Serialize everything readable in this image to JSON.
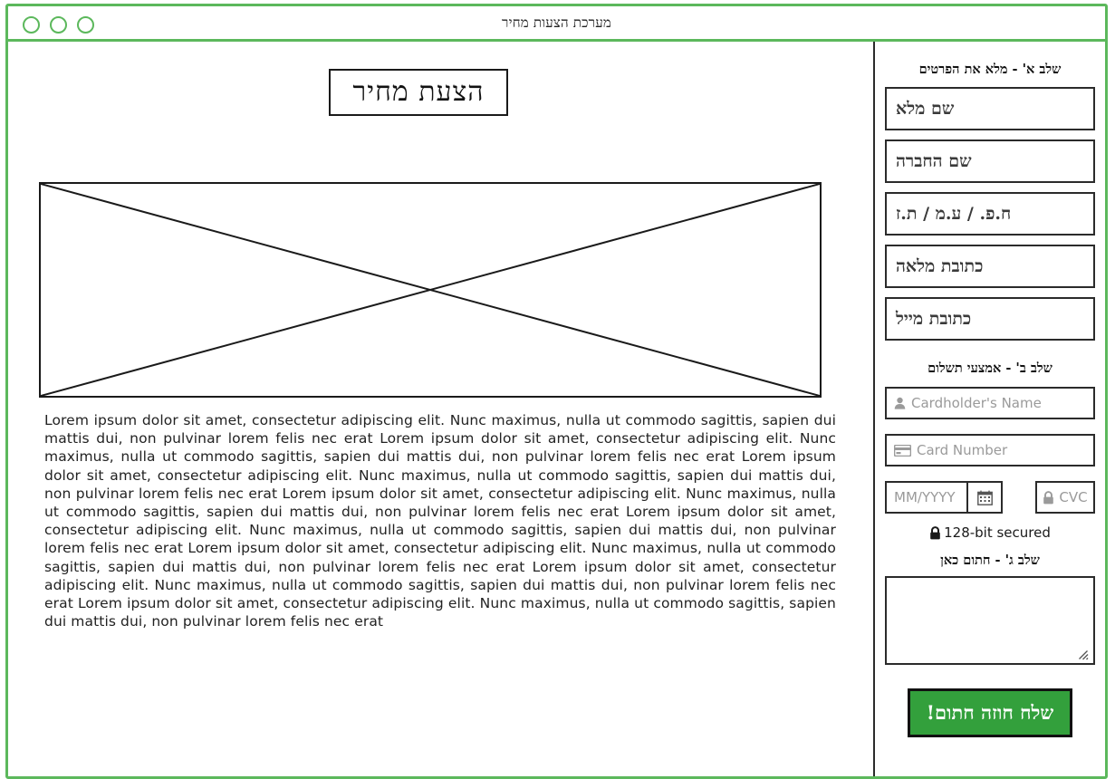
{
  "window": {
    "title": "מערכת הצעות מחיר",
    "controls": [
      "circle-1",
      "circle-2",
      "circle-3"
    ],
    "accent_color": "#5cb85c"
  },
  "content": {
    "document_title": "הצעת מחיר",
    "image_placeholder": "image-placeholder",
    "body_text": "Lorem ipsum dolor sit amet, consectetur adipiscing elit. Nunc maximus, nulla ut commodo sagittis, sapien dui mattis dui, non pulvinar lorem felis nec erat Lorem ipsum dolor sit amet, consectetur adipiscing elit. Nunc maximus, nulla ut commodo sagittis, sapien dui mattis dui, non pulvinar lorem felis nec erat Lorem ipsum dolor sit amet, consectetur adipiscing elit. Nunc maximus, nulla ut commodo sagittis, sapien dui mattis dui, non pulvinar lorem felis nec erat Lorem ipsum dolor sit amet, consectetur adipiscing elit. Nunc maximus, nulla ut commodo sagittis, sapien dui mattis dui, non pulvinar lorem felis nec erat Lorem ipsum dolor sit amet, consectetur adipiscing elit. Nunc maximus, nulla ut commodo sagittis, sapien dui mattis dui, non pulvinar lorem felis nec erat Lorem ipsum dolor sit amet, consectetur adipiscing elit. Nunc maximus, nulla ut commodo sagittis, sapien dui mattis dui, non pulvinar lorem felis nec erat Lorem ipsum dolor sit amet, consectetur adipiscing elit. Nunc maximus, nulla ut commodo sagittis, sapien dui mattis dui, non pulvinar lorem felis nec erat Lorem ipsum dolor sit amet, consectetur adipiscing elit. Nunc maximus, nulla ut commodo sagittis, sapien dui mattis dui, non pulvinar lorem felis nec erat"
  },
  "sidebar": {
    "step_a": {
      "label": "שלב א' - מלא את הפרטים",
      "fields": [
        {
          "name": "full-name",
          "label": "שם מלא"
        },
        {
          "name": "company-name",
          "label": "שם החברה"
        },
        {
          "name": "company-id",
          "label": "ח.פ. / ע.מ / ת.ז"
        },
        {
          "name": "full-address",
          "label": "כתובת מלאה"
        },
        {
          "name": "email-address",
          "label": "כתובת מייל"
        }
      ]
    },
    "step_b": {
      "label": "שלב ב' - אמצעי תשלום",
      "cardholder_placeholder": "Cardholder's Name",
      "cardnumber_placeholder": "Card Number",
      "expiry_placeholder": "MM/YYYY",
      "cvc_placeholder": "CVC",
      "secured_text": "128-bit secured",
      "icons": {
        "cardholder": "user-icon",
        "cardnumber": "credit-card-icon",
        "expiry": "calendar-icon",
        "cvc": "lock-icon",
        "secured": "lock-icon"
      }
    },
    "step_c": {
      "label": "שלב ג' - חתום כאן",
      "signature_value": "",
      "resize_handle": "resize-handle-icon"
    },
    "submit_button": {
      "label": "שלח חוזה חתום!",
      "color": "#33a03c"
    }
  }
}
